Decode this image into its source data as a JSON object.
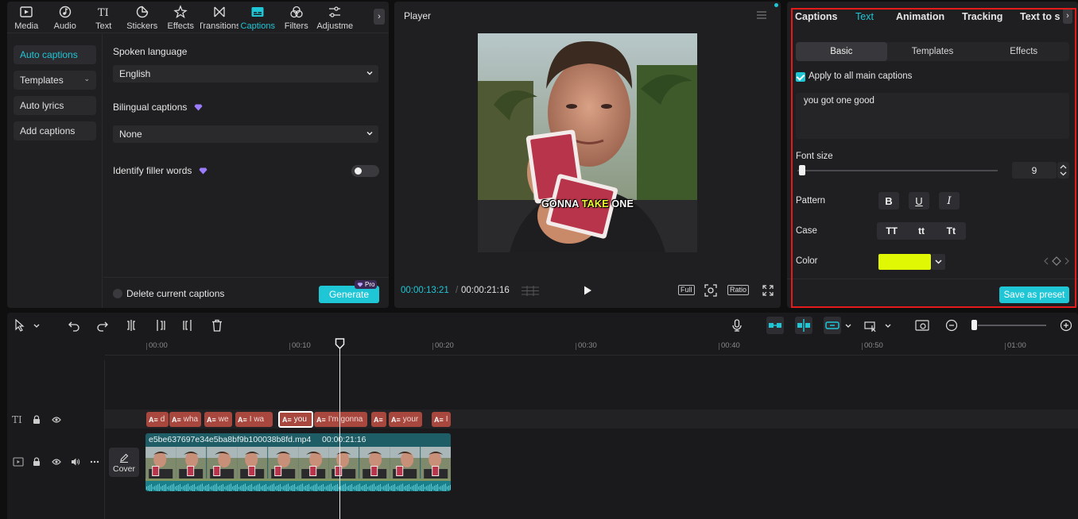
{
  "left_panel": {
    "tabs": [
      {
        "label": "Media",
        "icon": "media-icon"
      },
      {
        "label": "Audio",
        "icon": "audio-icon"
      },
      {
        "label": "Text",
        "icon": "text-icon"
      },
      {
        "label": "Stickers",
        "icon": "stickers-icon"
      },
      {
        "label": "Effects",
        "icon": "effects-icon"
      },
      {
        "label": "Transitions",
        "icon": "transitions-icon"
      },
      {
        "label": "Captions",
        "icon": "captions-icon",
        "active": true
      },
      {
        "label": "Filters",
        "icon": "filters-icon"
      },
      {
        "label": "Adjustme",
        "icon": "adjustment-icon"
      }
    ],
    "sidebar": {
      "items": [
        {
          "label": "Auto captions",
          "active": true
        },
        {
          "label": "Templates"
        },
        {
          "label": "Auto lyrics"
        },
        {
          "label": "Add captions"
        }
      ]
    },
    "captions": {
      "spoken_language_label": "Spoken language",
      "spoken_language_value": "English",
      "bilingual_label": "Bilingual captions",
      "bilingual_value": "None",
      "filler_label": "Identify filler words",
      "delete_label": "Delete current captions",
      "generate_label": "Generate",
      "pro_label": "Pro"
    }
  },
  "player": {
    "title": "Player",
    "caption_words": {
      "w1": "GONNA",
      "w2": "TAKE",
      "w3": "ONE"
    },
    "current_time": "00:00:13:21",
    "total_time": "00:00:21:16",
    "full_label": "Full",
    "ratio_label": "Ratio"
  },
  "right_panel": {
    "tabs": [
      "Captions",
      "Text",
      "Animation",
      "Tracking",
      "Text to s"
    ],
    "active_tab": "Text",
    "subtabs": [
      "Basic",
      "Templates",
      "Effects"
    ],
    "apply_all_label": "Apply to all main captions",
    "caption_text": "you got one good",
    "font_size_label": "Font size",
    "font_size_value": "9",
    "font_size_fraction": 0.02,
    "pattern_label": "Pattern",
    "pattern_buttons": [
      "B",
      "U",
      "I"
    ],
    "case_label": "Case",
    "case_buttons": [
      "TT",
      "tt",
      "Tt"
    ],
    "color_label": "Color",
    "color_value": "#e1f805",
    "save_preset_label": "Save as preset"
  },
  "timeline": {
    "ruler": [
      "00:00",
      "00:10",
      "00:20",
      "00:30",
      "00:40",
      "00:50",
      "01:00"
    ],
    "caption_clips": [
      {
        "text": "d"
      },
      {
        "text": "wha"
      },
      {
        "text": "we"
      },
      {
        "text": "I wa"
      },
      {
        "text": "you",
        "selected": true
      },
      {
        "text": "I'm gonna"
      },
      {
        "text": ""
      },
      {
        "text": "your"
      },
      {
        "text": "I"
      }
    ],
    "video_clip": {
      "name": "e5be637697e34e5ba8bf9b100038b8fd.mp4",
      "duration": "00:00:21:16"
    },
    "cover_label": "Cover"
  }
}
